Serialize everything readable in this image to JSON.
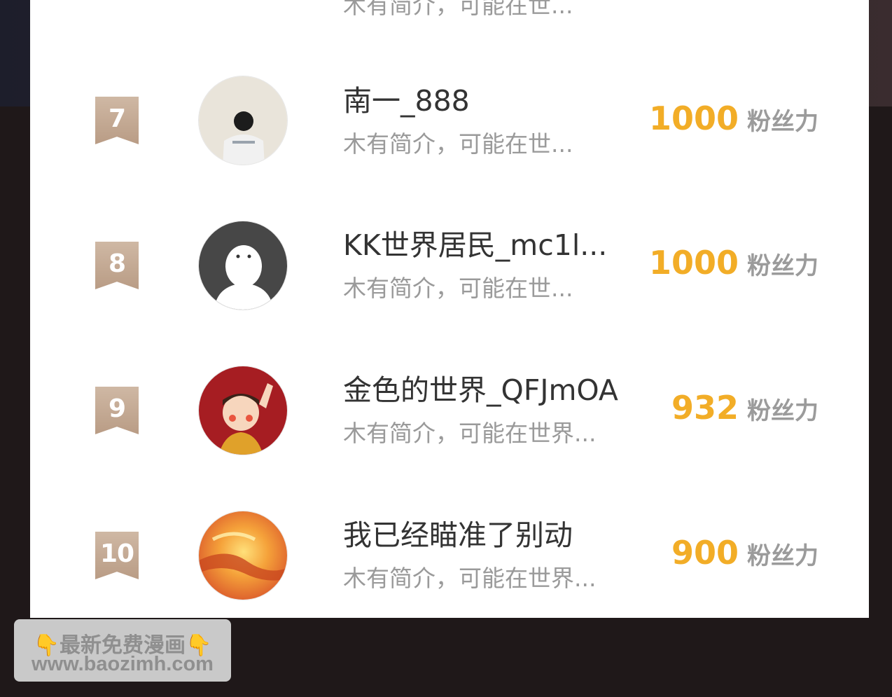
{
  "ranking": {
    "partial_top": {
      "desc": "木有简介，可能在世..."
    },
    "rows": [
      {
        "rank": "7",
        "name": "南一_888",
        "desc": "木有简介，可能在世...",
        "score": "1000",
        "unit": "粉丝力"
      },
      {
        "rank": "8",
        "name": "KK世界居民_mc1l...",
        "desc": "木有简介，可能在世...",
        "score": "1000",
        "unit": "粉丝力"
      },
      {
        "rank": "9",
        "name": "金色的世界_QFJmOA",
        "desc": "木有简介，可能在世界...",
        "score": "932",
        "unit": "粉丝力"
      },
      {
        "rank": "10",
        "name": "我已经瞄准了别动",
        "desc": "木有简介，可能在世界...",
        "score": "900",
        "unit": "粉丝力"
      }
    ]
  },
  "watermark": {
    "line1": "最新免费漫画",
    "hand_icon": "👇",
    "line2": "www.baozimh.com"
  },
  "colors": {
    "score": "#f2ad27",
    "rank_badge": "#c4a893",
    "unit": "#9b9b9b"
  }
}
